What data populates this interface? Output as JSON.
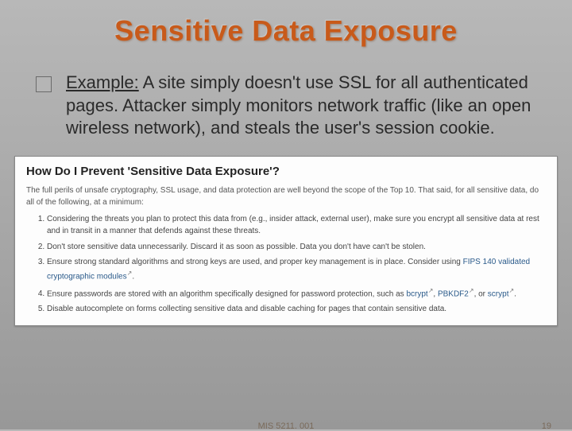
{
  "title": "Sensitive Data Exposure",
  "example": {
    "label": "Example:",
    "text": " A site simply doesn't use SSL for all authenticated pages. Attacker simply monitors network traffic (like an open wireless network), and steals the user's session cookie."
  },
  "inset": {
    "heading": "How Do I Prevent 'Sensitive Data Exposure'?",
    "intro": "The full perils of unsafe cryptography, SSL usage, and data protection are well beyond the scope of the Top 10. That said, for all sensitive data, do all of the following, at a minimum:",
    "items": [
      {
        "text": "Considering the threats you plan to protect this data from (e.g., insider attack, external user), make sure you encrypt all sensitive data at rest and in transit in a manner that defends against these threats."
      },
      {
        "text": "Don't store sensitive data unnecessarily. Discard it as soon as possible. Data you don't have can't be stolen."
      },
      {
        "prefix": "Ensure strong standard algorithms and strong keys are used, and proper key management is in place. Consider using ",
        "links": [
          "FIPS 140 validated cryptographic modules"
        ],
        "suffix": "."
      },
      {
        "prefix": "Ensure passwords are stored with an algorithm specifically designed for password protection, such as ",
        "links": [
          "bcrypt",
          "PBKDF2",
          "scrypt"
        ],
        "suffix": "."
      },
      {
        "text": "Disable autocomplete on forms collecting sensitive data and disable caching for pages that contain sensitive data."
      }
    ]
  },
  "footer": {
    "center": "MIS 5211. 001",
    "right": "19"
  }
}
